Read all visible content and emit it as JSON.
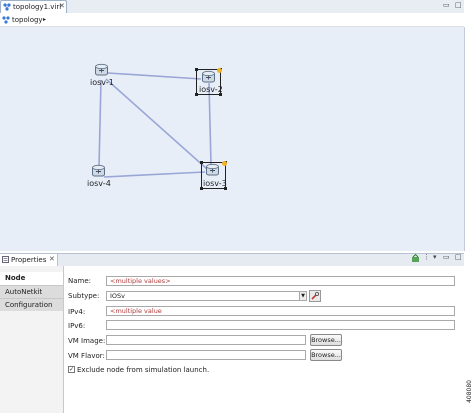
{
  "editor": {
    "tab_label": "topology1.virl",
    "tab_close": "✕",
    "breadcrumb_label": "topology",
    "breadcrumb_arrow": "▸"
  },
  "canvas": {
    "nodes": [
      {
        "label": "iosv-1"
      },
      {
        "label": "iosv-2"
      },
      {
        "label": "iosv-3"
      },
      {
        "label": "iosv-4"
      }
    ],
    "link_color": "#9aa6d6"
  },
  "properties": {
    "tab_label": "Properties",
    "tab_close": "✕",
    "sidebar_items": [
      "Node",
      "AutoNetkit",
      "Configuration"
    ],
    "fields": {
      "name_label": "Name:",
      "name_value": "<multiple values>",
      "subtype_label": "Subtype:",
      "subtype_value": "IOSv",
      "ipv4_label": "IPv4:",
      "ipv4_value": "<multiple value",
      "ipv6_label": "IPv6:",
      "ipv6_value": "",
      "vm_image_label": "VM Image:",
      "vm_image_value": "",
      "vm_flavor_label": "VM Flavor:",
      "vm_flavor_value": ""
    },
    "browse_label": "Browse...",
    "exclude_label": "Exclude node from simulation launch.",
    "exclude_checked": true
  },
  "figure_id": "408080",
  "colors": {
    "canvas_bg": "#e8eef8",
    "value_red": "#b23a3a"
  }
}
